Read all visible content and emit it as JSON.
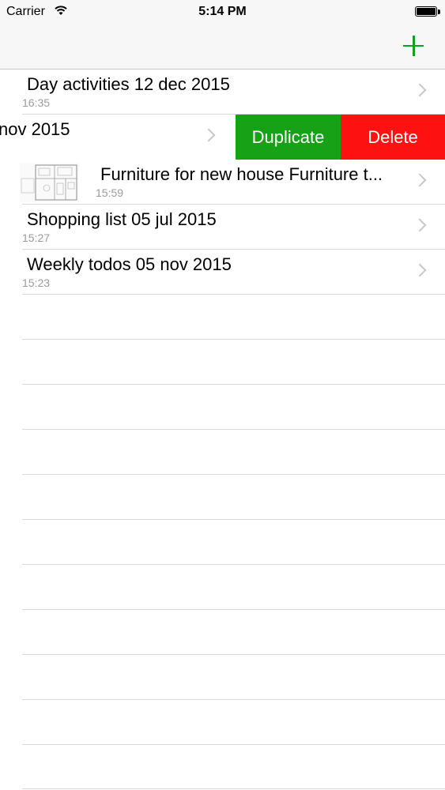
{
  "status_bar": {
    "carrier": "Carrier",
    "time": "5:14 PM"
  },
  "nav": {
    "add_icon": "plus-icon"
  },
  "rows": [
    {
      "title": "Day activities 12 dec 2015",
      "time": "16:35"
    },
    {
      "title": "nov 2015",
      "time": "",
      "swipe_actions": {
        "duplicate": "Duplicate",
        "delete": "Delete"
      }
    },
    {
      "title": "Furniture for new house Furniture t...",
      "time": "15:59",
      "thumbnail": "floorplan-image"
    },
    {
      "title": "Shopping list 05 jul 2015",
      "time": "15:27"
    },
    {
      "title": "Weekly todos 05 nov 2015",
      "time": "15:23"
    }
  ],
  "colors": {
    "accent": "#14a01e",
    "duplicate": "#16a116",
    "delete": "#fd1111"
  }
}
